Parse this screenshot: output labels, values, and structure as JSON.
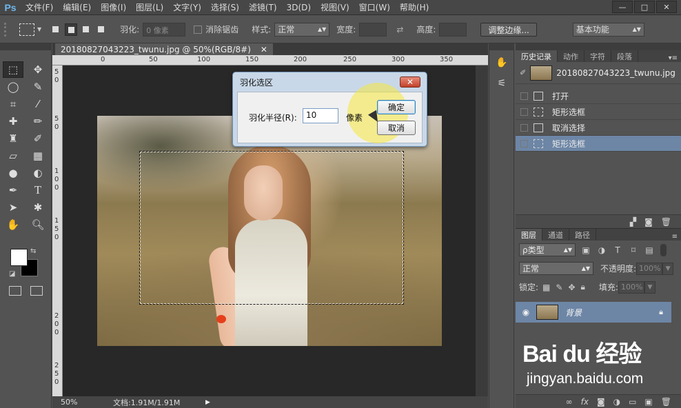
{
  "app": {
    "logo": "Ps"
  },
  "menu": [
    "文件(F)",
    "编辑(E)",
    "图像(I)",
    "图层(L)",
    "文字(Y)",
    "选择(S)",
    "滤镜(T)",
    "3D(D)",
    "视图(V)",
    "窗口(W)",
    "帮助(H)"
  ],
  "window_controls": {
    "minimize": "—",
    "restore": "□",
    "close": "✕"
  },
  "options": {
    "feather_label": "羽化:",
    "feather_value": "0 像素",
    "antialias_label": "消除锯齿",
    "style_label": "样式:",
    "style_value": "正常",
    "width_label": "宽度:",
    "height_label": "高度:",
    "refine_edge_button": "调整边缘...",
    "workspace_value": "基本功能"
  },
  "document": {
    "tab_title": "20180827043223_twunu.jpg @ 50%(RGB/8#)",
    "tab_close": "✕",
    "ruler_top": [
      "0",
      "50",
      "100",
      "150",
      "200",
      "250",
      "300",
      "350"
    ],
    "ruler_left": [
      "5",
      "0",
      "5",
      "0",
      "1",
      "0",
      "0",
      "1",
      "5",
      "0",
      "2",
      "0",
      "0",
      "2",
      "5",
      "0"
    ],
    "zoom": "50%",
    "doc_info": "文档:1.91M/1.91M"
  },
  "dialog": {
    "title": "羽化选区",
    "close": "✕",
    "radius_label": "羽化半径(R):",
    "radius_value": "10",
    "unit": "像素",
    "ok": "确定",
    "cancel": "取消"
  },
  "history": {
    "tabs": [
      "历史记录",
      "动作",
      "字符",
      "段落"
    ],
    "snapshot_name": "20180827043223_twunu.jpg",
    "items": [
      {
        "label": "打开",
        "icon": "doc-icon"
      },
      {
        "label": "矩形选框",
        "icon": "marquee-icon"
      },
      {
        "label": "取消选择",
        "icon": "doc-icon"
      },
      {
        "label": "矩形选框",
        "icon": "marquee-icon",
        "active": true
      }
    ]
  },
  "layers": {
    "tabs": [
      "图层",
      "通道",
      "路径"
    ],
    "filter_kind": "ρ类型",
    "blend_mode": "正常",
    "opacity_label": "不透明度:",
    "opacity_value": "100%",
    "lock_label": "锁定:",
    "fill_label": "填充:",
    "fill_value": "100%",
    "layer_name": "背景"
  },
  "watermark": {
    "logo": "Bai du 经验",
    "url": "jingyan.baidu.com"
  },
  "colors": {
    "selection_highlight": "#6d86a6",
    "dialog_bg": "#c9d8e8",
    "spotlight": "#f5e83c"
  }
}
